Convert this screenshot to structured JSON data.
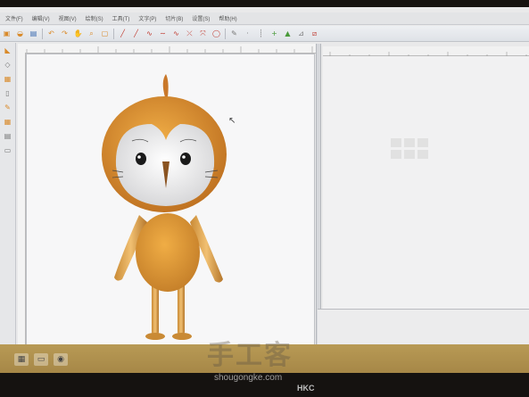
{
  "menu": {
    "items": [
      "文件(F)",
      "编辑(V)",
      "视图(V)",
      "绘制(S)",
      "工具(T)",
      "文字(P)",
      "切片(B)",
      "设置(S)",
      "帮助(H)"
    ]
  },
  "icons": {
    "toolbar": [
      "new-icon",
      "open-icon",
      "save-icon",
      "undo-icon",
      "redo-icon",
      "pan-icon",
      "zoom-icon",
      "select-icon",
      "line-icon",
      "curve-icon",
      "wave-icon",
      "node-icon",
      "circle-icon",
      "pen-icon",
      "fill-icon",
      "scale-icon",
      "eraser-icon"
    ],
    "left": [
      "pointer-icon",
      "node-icon",
      "layer-icon",
      "text-icon",
      "pencil-icon",
      "layer-icon",
      "slice-icon",
      "print-icon"
    ]
  },
  "watermark": {
    "main": "手工客",
    "sub": "shougongke.com"
  },
  "monitor_brand": "HKC",
  "colors": {
    "character_orange": "#e79a2f",
    "character_face": "#f2f2f2",
    "taskbar": "#b0904d"
  }
}
